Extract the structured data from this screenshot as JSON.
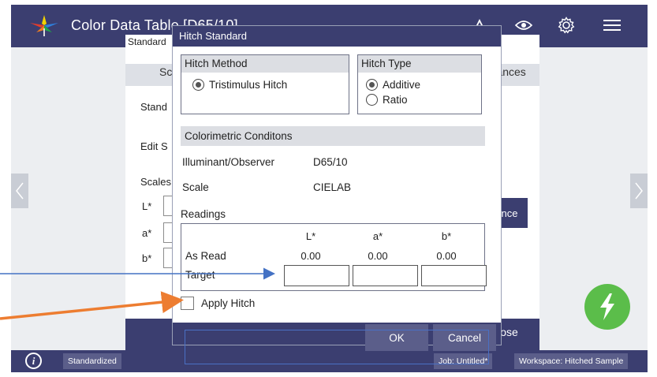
{
  "app": {
    "title": "Color Data Table [D65/10]",
    "colors": {
      "primary": "#3b3e70",
      "accent": "#5bbd4a",
      "annotation_blue": "#4472c4",
      "annotation_orange": "#ed7d31"
    }
  },
  "topbar": {
    "icons": [
      "warning-triangle-icon",
      "eye-icon",
      "gear-icon",
      "menu-icon"
    ]
  },
  "background_panel": {
    "title_fragment": "Standard",
    "tab_left_fragment": "Sc",
    "tab_right_fragment": "erances",
    "labels": [
      "Stand",
      "Edit S",
      "Scales"
    ],
    "scale_labels": [
      "L*",
      "a*",
      "b*"
    ],
    "tolerance_button_fragment": "rance",
    "close_label": "Close"
  },
  "dialog": {
    "title": "Hitch Standard",
    "hitch_method": {
      "heading": "Hitch Method",
      "options": [
        {
          "label": "Tristimulus Hitch",
          "selected": true
        }
      ]
    },
    "hitch_type": {
      "heading": "Hitch Type",
      "options": [
        {
          "label": "Additive",
          "selected": true
        },
        {
          "label": "Ratio",
          "selected": false
        }
      ]
    },
    "colorimetric": {
      "heading": "Colorimetric Conditons",
      "rows": [
        {
          "label": "Illuminant/Observer",
          "value": "D65/10"
        },
        {
          "label": "Scale",
          "value": "CIELAB"
        }
      ]
    },
    "readings": {
      "heading": "Readings",
      "columns": [
        "L*",
        "a*",
        "b*"
      ],
      "as_read_label": "As Read",
      "as_read_values": [
        "0.00",
        "0.00",
        "0.00"
      ],
      "target_label": "Target",
      "target_values": [
        "",
        "",
        ""
      ]
    },
    "apply_hitch": {
      "label": "Apply Hitch",
      "checked": false
    },
    "buttons": {
      "ok": "OK",
      "cancel": "Cancel"
    }
  },
  "statusbar": {
    "standardized": "Standardized",
    "job": "Job: Untitled*",
    "workspace": "Workspace: Hitched Sample"
  }
}
